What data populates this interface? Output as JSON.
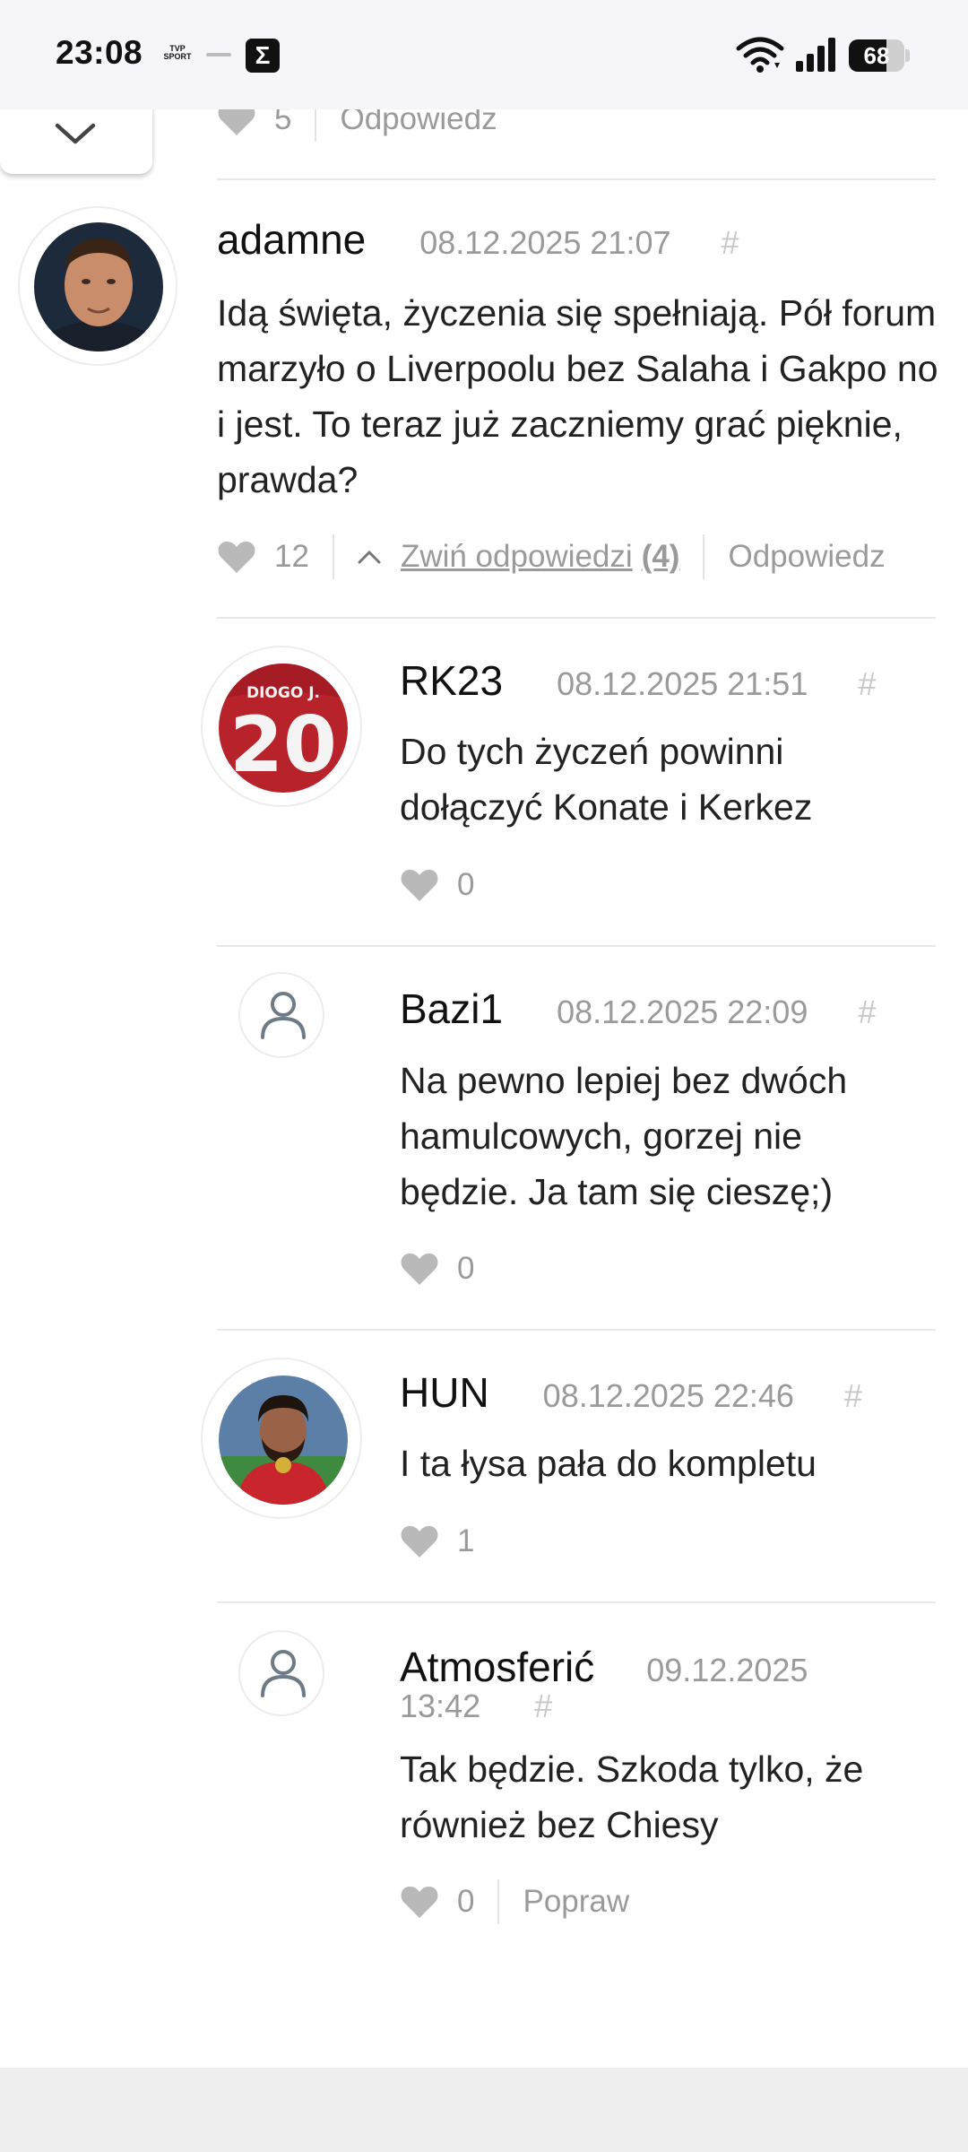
{
  "status_bar": {
    "time": "23:08",
    "apps": [
      "TVP SPORT",
      "news-app",
      "sigma-app"
    ],
    "tvp_line1": "TVP",
    "tvp_line2": "SPORT",
    "sigma": "Σ",
    "battery": "68",
    "battery_level": 0.68
  },
  "prev_comment": {
    "likes": "5",
    "reply_label": "Odpowiedz"
  },
  "comments": [
    {
      "user": "adamne",
      "date": "08.12.2025 21:07",
      "hash": "#",
      "text": "Idą święta, życzenia się spełniają. Pół forum marzyło o Liverpoolu bez Salaha i Gakpo no i jest. To teraz już zaczniemy grać pięknie, prawda?",
      "likes": "12",
      "toggle_label": "Zwiń odpowiedzi",
      "toggle_count": "(4)",
      "reply_label": "Odpowiedz"
    },
    {
      "user": "RK23",
      "date": "08.12.2025 21:51",
      "hash": "#",
      "text": "Do tych życzeń powinni dołączyć Konate i Kerkez",
      "likes": "0",
      "avatar_text_top": "DIOGO J.",
      "avatar_text_num": "20"
    },
    {
      "user": "Bazi1",
      "date": "08.12.2025 22:09",
      "hash": "#",
      "text": "Na pewno lepiej bez dwóch hamulcowych, gorzej nie będzie. Ja tam się cieszę;)",
      "likes": "0"
    },
    {
      "user": "HUN",
      "date": "08.12.2025 22:46",
      "hash": "#",
      "text": "I ta łysa pała do kompletu",
      "likes": "1"
    },
    {
      "user": "Atmosferić",
      "date_part1": "09.12.2025",
      "date_part2": "13:42",
      "hash": "#",
      "text": "Tak będzie. Szkoda tylko, że również bez Chiesy",
      "likes": "0",
      "edit_label": "Popraw"
    }
  ],
  "colors": {
    "muted": "#9a9a9a",
    "heart": "#b9b9b9",
    "divider": "#e8e8e8",
    "accent_red": "#c0282d"
  }
}
